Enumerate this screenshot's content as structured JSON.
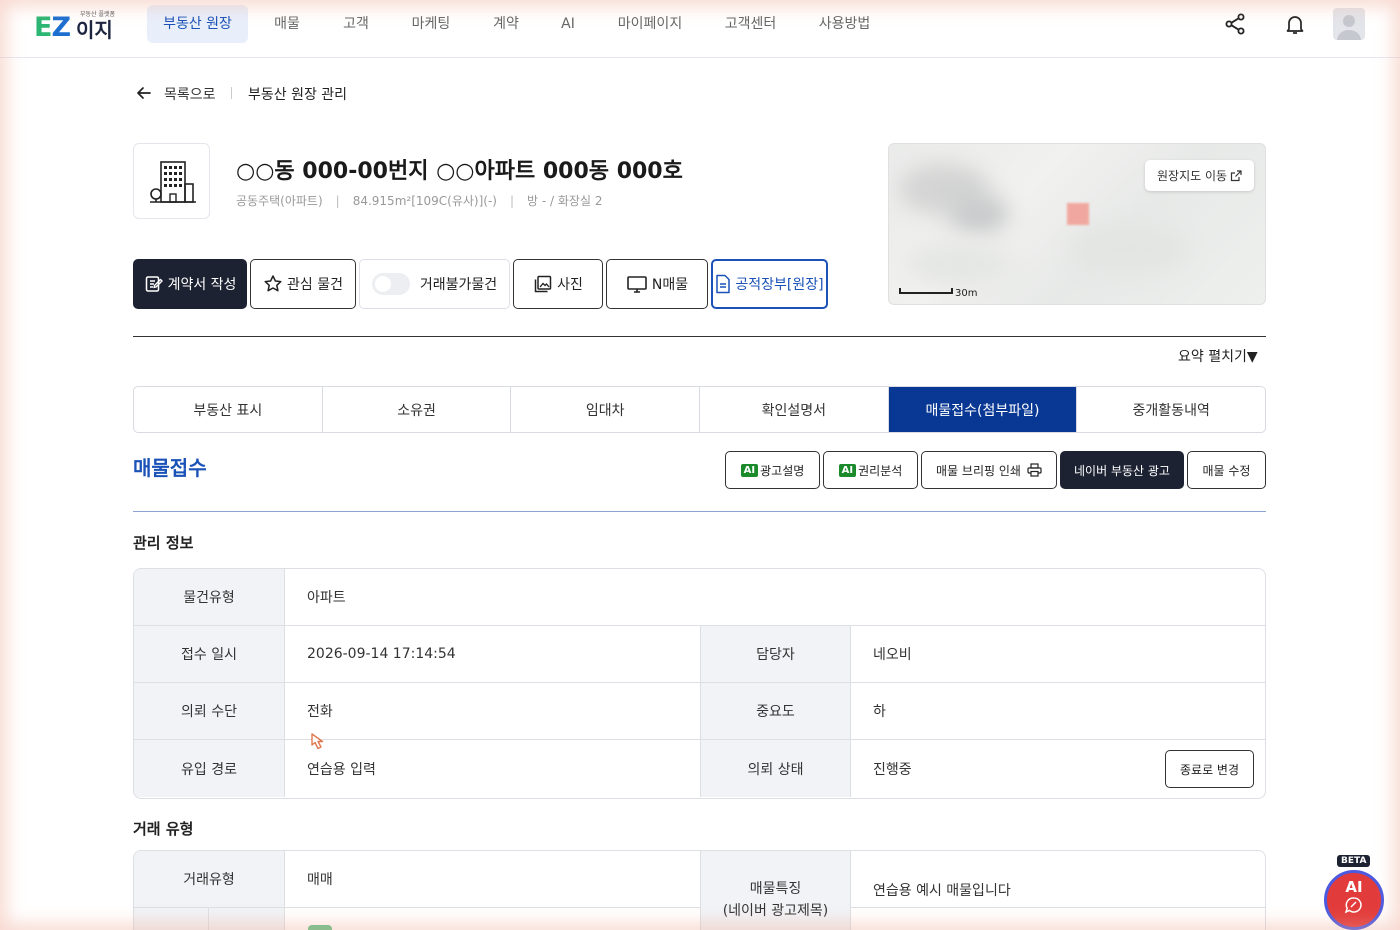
{
  "logo": {
    "tiny": "부동산 플랫폼",
    "brand": "이지"
  },
  "nav": [
    "부동산 원장",
    "매물",
    "고객",
    "마케팅",
    "계약",
    "AI",
    "마이페이지",
    "고객센터",
    "사용방법"
  ],
  "breadcrumb": {
    "back": "목록으로",
    "current": "부동산 원장 관리"
  },
  "property": {
    "title": "○○동 000-00번지 ○○아파트 000동 000호",
    "type": "공동주택(아파트)",
    "area": "84.915m²[109C(유사)](-)",
    "rooms": "방 - / 화장실 2"
  },
  "actions": {
    "contract": "계약서 작성",
    "favorite": "관심 물건",
    "untradeable": "거래불가물건",
    "photo": "사진",
    "nlisting": "N매물",
    "ledger": "공적장부[원장]"
  },
  "map": {
    "button": "원장지도 이동",
    "scale": "30m"
  },
  "summary_toggle": "요약 펼치기▼",
  "tabs": [
    "부동산 표시",
    "소유권",
    "임대차",
    "확인설명서",
    "매물접수(첨부파일)",
    "중개활동내역"
  ],
  "section": {
    "title": "매물접수",
    "ai_label": "AI",
    "btn_ad_desc": "광고설명",
    "btn_rights": "권리분석",
    "btn_print": "매물 브리핑 인쇄",
    "btn_naver": "네이버 부동산 광고",
    "btn_edit": "매물 수정"
  },
  "management": {
    "title": "관리 정보",
    "type_label": "물건유형",
    "type_value": "아파트",
    "date_label": "접수 일시",
    "date_value": "2026-09-14 17:14:54",
    "manager_label": "담당자",
    "manager_value": "네오비",
    "method_label": "의뢰 수단",
    "method_value": "전화",
    "priority_label": "중요도",
    "priority_value": "하",
    "route_label": "유입 경로",
    "route_value": "연습용 입력",
    "status_label": "의뢰 상태",
    "status_value": "진행중",
    "status_button": "종료로 변경"
  },
  "deal": {
    "title": "거래 유형",
    "type_label": "거래유형",
    "type_value": "매매",
    "feature_label_1": "매물특징",
    "feature_label_2": "(네이버 광고제목)",
    "feature_value": "연습용 예시 매물입니다"
  },
  "ai_fab": {
    "beta": "BETA",
    "label": "AI"
  },
  "colors": {
    "primary": "#1a52b8",
    "active_tab": "#093894",
    "dark_button": "#1d2233",
    "ai_badge": "#1a8a2b",
    "fab": "#e23b3b"
  }
}
